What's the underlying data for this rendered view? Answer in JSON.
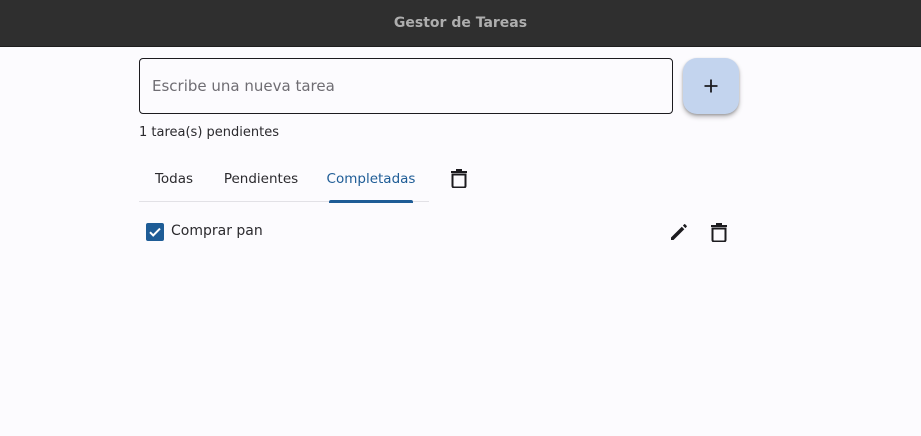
{
  "window": {
    "title": "Gestor de Tareas"
  },
  "new_task": {
    "placeholder": "Escribe una nueva tarea",
    "value": "",
    "add_icon": "plus-icon"
  },
  "summary": {
    "pending_text": "1 tarea(s) pendientes"
  },
  "tabs": [
    {
      "label": "Todas",
      "active": false
    },
    {
      "label": "Pendientes",
      "active": false
    },
    {
      "label": "Completadas",
      "active": true
    }
  ],
  "toolbar": {
    "clear_icon": "trash-icon"
  },
  "tasks": [
    {
      "label": "Comprar pan",
      "completed": true,
      "edit_icon": "pencil-icon",
      "delete_icon": "trash-icon"
    }
  ],
  "colors": {
    "accent": "#1e5c96",
    "titlebar": "#2f2f2f",
    "add_button": "#c3d4ee",
    "background": "#fcfbfe"
  }
}
